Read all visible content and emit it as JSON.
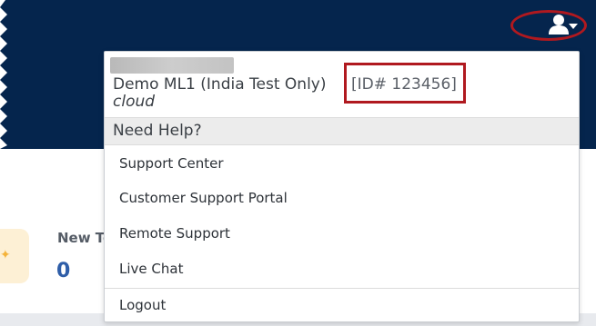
{
  "header": {
    "user_menu_icon": "user-dropdown-icon",
    "highlight_color": "#b0191f",
    "background_color": "#05254d"
  },
  "dashboard": {
    "stat_label": "New To",
    "stat_value": "0"
  },
  "account_menu": {
    "account_name": "Demo ML1 (India Test Only)",
    "account_id": "[ID# 123456]",
    "account_type": "cloud",
    "help_heading": "Need Help?",
    "items": [
      {
        "label": "Support Center"
      },
      {
        "label": "Customer Support Portal"
      },
      {
        "label": "Remote Support"
      },
      {
        "label": "Live Chat"
      }
    ],
    "logout_label": "Logout"
  }
}
